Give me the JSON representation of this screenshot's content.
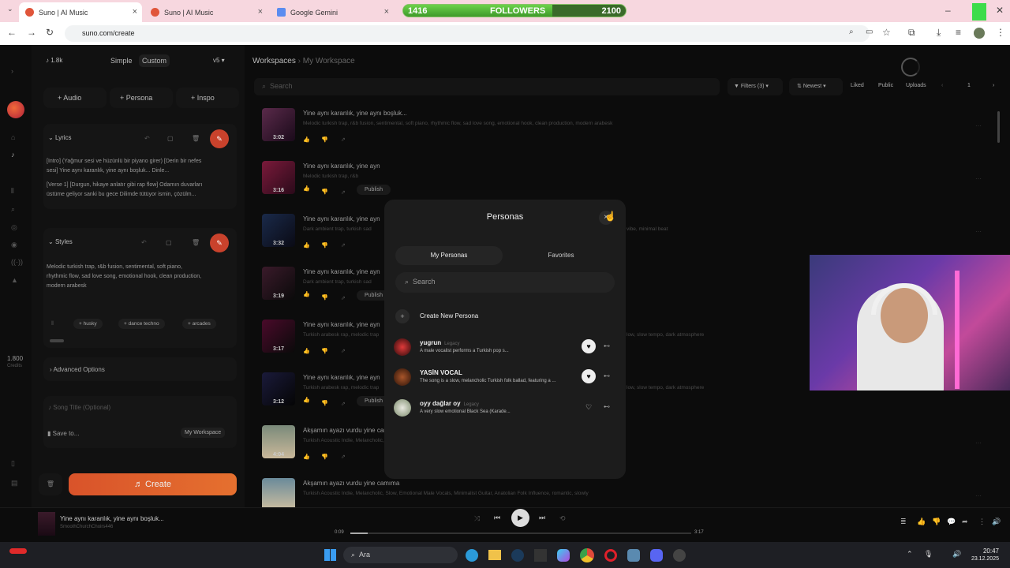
{
  "browser": {
    "tabs": [
      {
        "label": "Suno | AI Music"
      },
      {
        "label": "Suno | AI Music"
      },
      {
        "label": "Google Gemini"
      }
    ],
    "url": "suno.com/create",
    "followers": {
      "label": "FOLLOWERS",
      "current": "1416",
      "goal": "2100",
      "progress": 0.67
    }
  },
  "sidebar": {
    "credits_top": "1.8k",
    "mode_simple": "Simple",
    "mode_custom": "Custom",
    "version": "v5",
    "add_audio": "Audio",
    "add_persona": "Persona",
    "add_inspo": "Inspo",
    "lyrics_label": "Lyrics",
    "lyrics_line1": "[Intro] (Yağmur sesi ve hüzünlü bir piyano girer) [Derin bir nefes",
    "lyrics_line2": "sesi] Yine aynı karanlık, yine aynı boşluk... Dinle...",
    "lyrics_line3": "[Verse 1] [Durgun, hikaye anlatır gibi rap flow] Odamın duvarları",
    "lyrics_line4": "üstüme geliyor sanki bu gece Dilimde tütüyor ismin, çözülm...",
    "styles_label": "Styles",
    "styles_text": "Melodic turkish trap, r&b fusion, sentimental, soft piano, rhythmic flow, sad love song, emotional hook, clean production, modern arabesk",
    "tag1": "husky",
    "tag2": "dance techno",
    "tag3": "arcades",
    "advanced": "Advanced Options",
    "song_title_placeholder": "Song Title (Optional)",
    "save_to": "Save to...",
    "workspace": "My Workspace",
    "create": "Create",
    "credits_num": "1.800",
    "credits_label": "Credits"
  },
  "main": {
    "crumb_root": "Workspaces",
    "crumb_sep": "›",
    "crumb_current": "My Workspace",
    "search_placeholder": "Search",
    "filters": "Filters (3)",
    "sort": "Newest",
    "liked": "Liked",
    "public": "Public",
    "uploads": "Uploads",
    "page": "1",
    "publish": "Publish",
    "rows": [
      {
        "title": "Yine aynı karanlık, yine aynı boşluk...",
        "desc": "Melodic turkish trap, r&b fusion, sentimental, soft piano, rhythmic flow, sad love song, emotional hook, clean production, modern arabesk",
        "dur": "3:02"
      },
      {
        "title": "Yine aynı karanlık, yine ayn",
        "desc": "Melodic turkish trap, r&b",
        "dur": "3:16"
      },
      {
        "title": "Yine aynı karanlık, yine ayn",
        "desc": "Dark ambient trap, turkish sad",
        "right": "vibe, minimal beat",
        "dur": "3:32"
      },
      {
        "title": "Yine aynı karanlık, yine ayn",
        "desc": "Dark ambient trap, turkish sad",
        "dur": "3:19"
      },
      {
        "title": "Yine aynı karanlık, yine ayn",
        "desc": "Turkish arabesk rap, melodic trap",
        "right": "low, slow tempo, dark atmosphere",
        "dur": "3:17"
      },
      {
        "title": "Yine aynı karanlık, yine ayn",
        "desc": "Turkish arabesk rap, melodic trap",
        "right": "low, slow tempo, dark atmosphere",
        "dur": "3:12"
      },
      {
        "title": "Akşamın ayazı vurdu yine camıma",
        "desc": "Turkish Acoustic Indie, Melancholic, Slow, Emotional Male Vocal, Minimalist Guitar, Anatolian Folk Influence, romantic, slowly",
        "dur": "4:04"
      },
      {
        "title": "Akşamın ayazı vurdu yine camıma",
        "desc": "Turkish Acoustic Indie, Melancholic, Slow, Emotional Male Vocals, Minimalist Guitar, Anatolian Folk Influence, romantic, slowly",
        "dur": ""
      }
    ]
  },
  "modal": {
    "title": "Personas",
    "tab_mine": "My Personas",
    "tab_fav": "Favorites",
    "search_placeholder": "Search",
    "create_new": "Create New Persona",
    "personas": [
      {
        "name": "yugrun",
        "legacy": "Legacy",
        "desc": "A male vocalist performs a Turkish pop s..."
      },
      {
        "name": "YASİN VOCAL",
        "legacy": "",
        "desc": "The song is a slow, melancholic Turkish folk ballad, featuring a ..."
      },
      {
        "name": "oyy dağlar oy",
        "legacy": "Legacy",
        "desc": "A very slow emotional Black Sea (Karade..."
      }
    ]
  },
  "player": {
    "title": "Yine aynı karanlık, yine aynı boşluk...",
    "artist": "SmoothChurchChoirs446",
    "elapsed": "0:09",
    "total": "3:17",
    "progress": 0.05
  },
  "taskbar": {
    "search": "Ara",
    "time": "20:47",
    "date": "23.12.2025"
  }
}
